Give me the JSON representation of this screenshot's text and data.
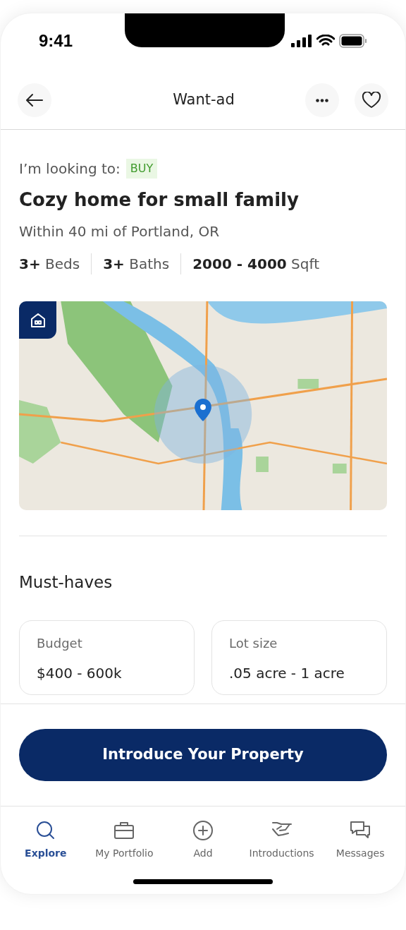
{
  "status_bar": {
    "time": "9:41"
  },
  "header": {
    "title": "Want-ad"
  },
  "intent": {
    "label": "I’m looking to:",
    "badge": "BUY"
  },
  "title": "Cozy home for small family",
  "location": "Within 40 mi of Portland, OR",
  "specs": [
    {
      "value": "3+",
      "unit": "Beds"
    },
    {
      "value": "3+",
      "unit": "Baths"
    },
    {
      "value": "2000 - 4000",
      "unit": "Sqft"
    }
  ],
  "must_haves": {
    "heading": "Must-haves",
    "cards": [
      {
        "label": "Budget",
        "value": "$400 - 600k"
      },
      {
        "label": "Lot size",
        "value": ".05 acre - 1 acre"
      }
    ]
  },
  "cta": "Introduce Your Property",
  "tabs": [
    {
      "kind": "explore",
      "label": "Explore",
      "selected": true
    },
    {
      "kind": "portfolio",
      "label": "My Portfolio",
      "selected": false
    },
    {
      "kind": "add",
      "label": "Add",
      "selected": false
    },
    {
      "kind": "introductions",
      "label": "Introductions",
      "selected": false
    },
    {
      "kind": "messages",
      "label": "Messages",
      "selected": false
    }
  ]
}
